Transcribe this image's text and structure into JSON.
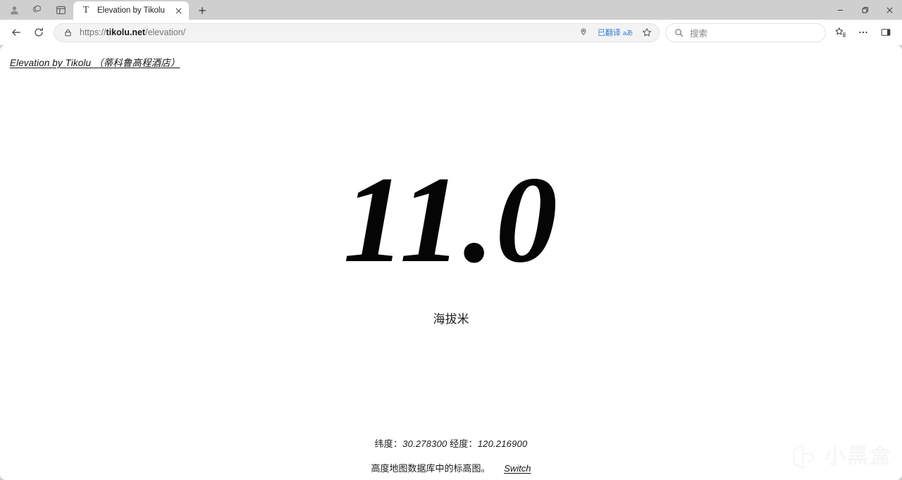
{
  "window": {
    "controls": {
      "minimize": "–",
      "restore": "❐",
      "close": "✕"
    }
  },
  "tabstrip": {
    "left_icons": [
      {
        "name": "profile-avatar",
        "label": "Profile"
      },
      {
        "name": "workspaces-icon",
        "label": "Workspaces"
      },
      {
        "name": "tab-actions-icon",
        "label": "Tab actions"
      }
    ],
    "tabs": [
      {
        "favicon_letter": "T",
        "title": "Elevation by Tikolu",
        "close": "✕"
      }
    ],
    "new_tab_label": "+"
  },
  "toolbar": {
    "back_label": "←",
    "reload_label": "⟳",
    "address": {
      "scheme": "https://",
      "domain": "tikolu.net",
      "path": "/elevation/",
      "lock_icon": "lock-icon"
    },
    "omnibox_icons": [
      {
        "name": "split-screen-icon",
        "glyph": "◎"
      }
    ],
    "translate_chip": {
      "label": "已翻译",
      "sub": "aあ",
      "color": "#2f7fd4"
    },
    "favorite_label": "☆",
    "search": {
      "placeholder": "搜索",
      "icon": "search-icon"
    },
    "collections_label": "collections-icon",
    "settings_label": "…",
    "sidebar_label": "sidebar-toggle-icon"
  },
  "page": {
    "site_title": "Elevation by Tikolu  （蒂科鲁高程酒店）",
    "elevation_value": "11.0",
    "elevation_unit": "海拔米",
    "coords": {
      "lat_label": "纬度：",
      "lat_value": "30.278300",
      "lon_label": "经度：",
      "lon_value": "120.216900"
    },
    "source_text": "高度地图数据库中的标高图。",
    "switch_label": "Switch"
  },
  "watermark": {
    "text": "小黑盒"
  },
  "colors": {
    "tabstrip_bg": "#cfcfcf",
    "toolbar_bg": "#ffffff",
    "page_bg": "#ffffff",
    "accent_blue": "#2f7fd4",
    "text_primary": "#141414"
  }
}
